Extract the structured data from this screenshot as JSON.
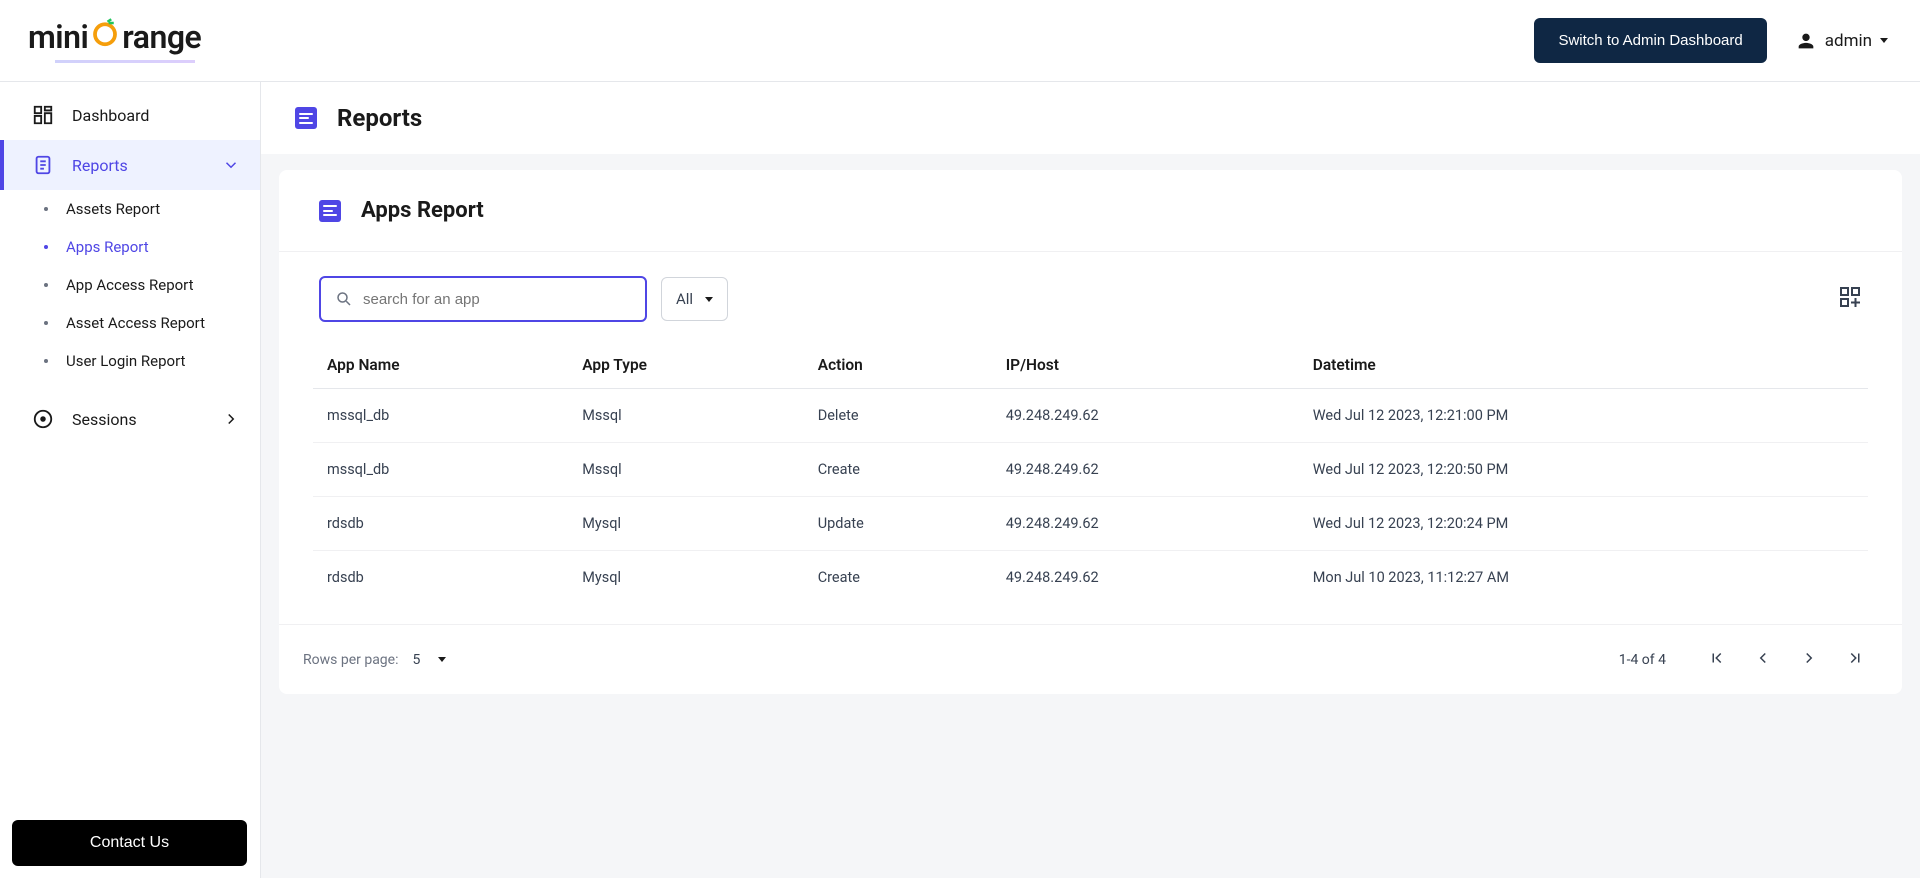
{
  "header": {
    "logo_text_1": "mini",
    "logo_text_2": "range",
    "switch_btn": "Switch to Admin Dashboard",
    "user_name": "admin"
  },
  "sidebar": {
    "dashboard": "Dashboard",
    "reports": "Reports",
    "subs": [
      {
        "label": "Assets Report"
      },
      {
        "label": "Apps Report"
      },
      {
        "label": "App Access Report"
      },
      {
        "label": "Asset Access Report"
      },
      {
        "label": "User Login Report"
      }
    ],
    "sessions": "Sessions",
    "contact": "Contact Us"
  },
  "page": {
    "title": "Reports",
    "card_title": "Apps Report",
    "search_placeholder": "search for an app",
    "filter_value": "All"
  },
  "table": {
    "headers": [
      "App Name",
      "App Type",
      "Action",
      "IP/Host",
      "Datetime"
    ],
    "rows": [
      {
        "c": [
          "mssql_db",
          "Mssql",
          "Delete",
          "49.248.249.62",
          "Wed Jul 12 2023, 12:21:00 PM"
        ]
      },
      {
        "c": [
          "mssql_db",
          "Mssql",
          "Create",
          "49.248.249.62",
          "Wed Jul 12 2023, 12:20:50 PM"
        ]
      },
      {
        "c": [
          "rdsdb",
          "Mysql",
          "Update",
          "49.248.249.62",
          "Wed Jul 12 2023, 12:20:24 PM"
        ]
      },
      {
        "c": [
          "rdsdb",
          "Mysql",
          "Create",
          "49.248.249.62",
          "Mon Jul 10 2023, 11:12:27 AM"
        ]
      }
    ]
  },
  "footer": {
    "rows_label": "Rows per page:",
    "rows_value": "5",
    "page_info": "1-4 of 4"
  }
}
